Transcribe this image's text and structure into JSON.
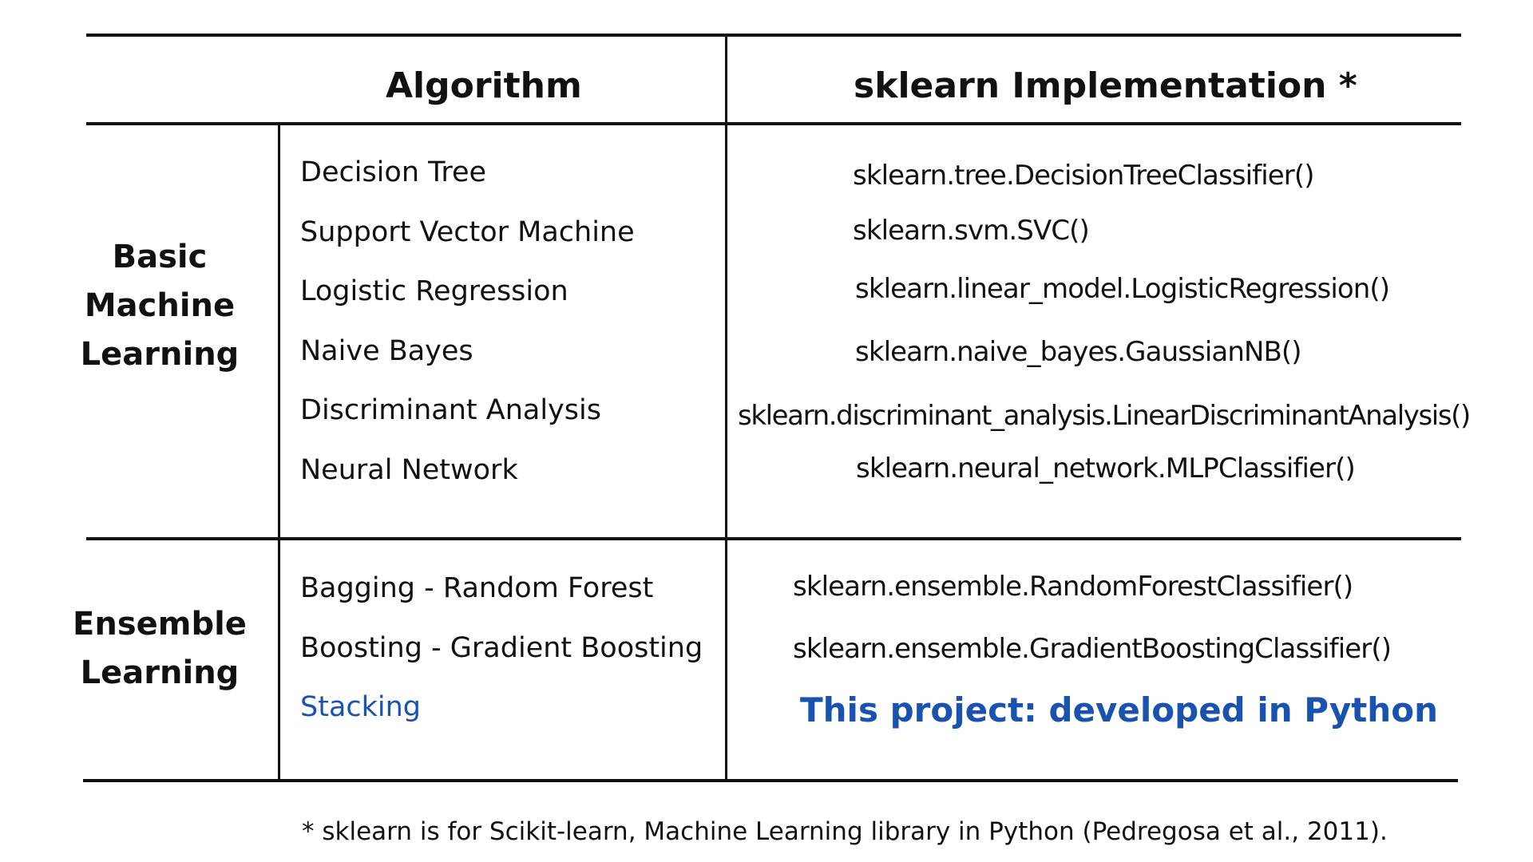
{
  "table": {
    "headers": {
      "algorithm": "Algorithm",
      "implementation": "sklearn Implementation *"
    },
    "groups": [
      {
        "label_lines": [
          "Basic",
          "Machine",
          "Learning"
        ],
        "rows": [
          {
            "algorithm": "Decision Tree",
            "implementation": "sklearn.tree.DecisionTreeClassifier()"
          },
          {
            "algorithm": "Support Vector Machine",
            "implementation": "sklearn.svm.SVC()"
          },
          {
            "algorithm": "Logistic Regression",
            "implementation": "sklearn.linear_model.LogisticRegression()"
          },
          {
            "algorithm": "Naive Bayes",
            "implementation": "sklearn.naive_bayes.GaussianNB()"
          },
          {
            "algorithm": "Discriminant Analysis",
            "implementation": "sklearn.discriminant_analysis.LinearDiscriminantAnalysis()"
          },
          {
            "algorithm": "Neural Network",
            "implementation": "sklearn.neural_network.MLPClassifier()"
          }
        ]
      },
      {
        "label_lines": [
          "Ensemble",
          "Learning"
        ],
        "rows": [
          {
            "algorithm": "Bagging - Random Forest",
            "implementation": "sklearn.ensemble.RandomForestClassifier()"
          },
          {
            "algorithm": "Boosting - Gradient Boosting",
            "implementation": "sklearn.ensemble.GradientBoostingClassifier()"
          },
          {
            "algorithm": "Stacking",
            "implementation": "This project: developed in Python"
          }
        ]
      }
    ]
  },
  "footnote": "* sklearn is for Scikit-learn, Machine Learning library in Python (Pedregosa et al., 2011).",
  "colors": {
    "text": "#111111",
    "highlight": "#1a52b0",
    "rules": "#111111"
  }
}
